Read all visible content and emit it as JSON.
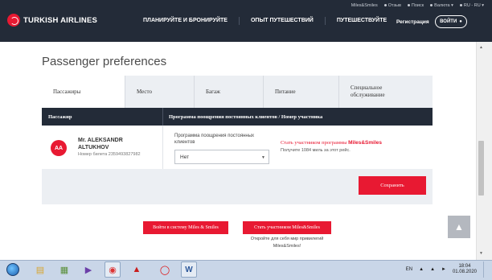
{
  "header": {
    "brand": "TURKISH AIRLINES",
    "util_links": [
      "Miles&Smiles",
      "Отзыв",
      "Поиск",
      "Валюта",
      "RU - RU"
    ],
    "nav": [
      "ПЛАНИРУЙТЕ И БРОНИРУЙТЕ",
      "ОПЫТ ПУТЕШЕСТВИЙ",
      "ПУТЕШЕСТВУЙТЕ"
    ],
    "register": "Регистрация",
    "login": "ВОЙТИ"
  },
  "page": {
    "title": "Passenger preferences",
    "tabs": [
      "Пассажиры",
      "Место",
      "Багаж",
      "Питание",
      "Специальное обслуживание"
    ],
    "table_head": {
      "col1": "Пассажир",
      "col2": "Программа поощрения постоянных клиентов / Номер участника"
    },
    "passenger": {
      "initials": "AA",
      "name": "Mr. ALEKSANDR ALTUKHOV",
      "ticket": "Номер билета 2359493827982"
    },
    "program_label": "Программа поощрения постоянных клиентов",
    "program_value": "Нет",
    "join_link_prefix": "Стать участником программы ",
    "join_link_brand": "Miles&Smiles",
    "miles_earn": "Получите 1084 миль за этот рейс.",
    "save": "Сохранить",
    "btn_login_ms": "Войти в систему Miles & Smiles",
    "btn_join_ms": "Стать участником Miles&Smiles",
    "promo": "Откройте для себя мир привилегий Miles&Smiles!"
  },
  "taskbar": {
    "lang": "EN",
    "time": "18:04",
    "date": "01.08.2020"
  },
  "colors": {
    "brand_red": "#e81932",
    "header_dark": "#232b38"
  }
}
